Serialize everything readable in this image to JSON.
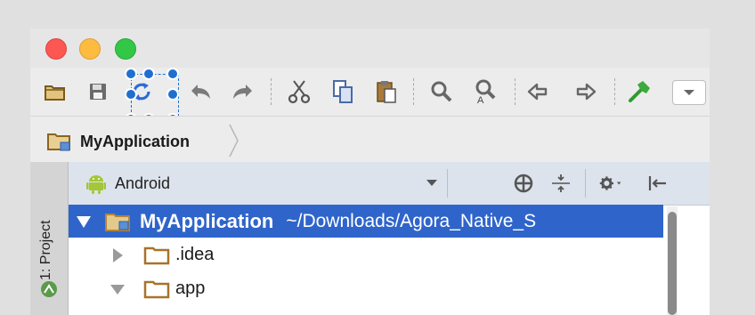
{
  "window": {
    "traffic_lights": [
      "close",
      "minimize",
      "zoom"
    ]
  },
  "toolbar": {
    "buttons": [
      {
        "icon": "open-folder-icon"
      },
      {
        "icon": "save-all-icon"
      },
      {
        "icon": "sync-icon"
      },
      {
        "icon": "undo-icon"
      },
      {
        "icon": "redo-icon"
      },
      {
        "icon": "cut-icon"
      },
      {
        "icon": "copy-icon"
      },
      {
        "icon": "paste-icon"
      },
      {
        "icon": "find-icon"
      },
      {
        "icon": "replace-icon"
      },
      {
        "icon": "back-icon"
      },
      {
        "icon": "forward-icon"
      },
      {
        "icon": "make-project-hammer-icon"
      },
      {
        "icon": "run-configuration-dropdown"
      }
    ],
    "selected_button": "sync-icon"
  },
  "breadcrumb": {
    "project": "MyApplication"
  },
  "side_tool_window": {
    "label": "1: Project"
  },
  "project_panel": {
    "view_mode": "Android",
    "header_actions": [
      "scroll-from-source-icon",
      "collapse-all-icon",
      "settings-icon",
      "hide-panel-icon"
    ],
    "tree": {
      "root": {
        "label": "MyApplication",
        "path": "~/Downloads/Agora_Native_S",
        "expanded": true,
        "selected": true
      },
      "children": [
        {
          "label": ".idea",
          "expanded": false
        },
        {
          "label": "app",
          "expanded": true
        }
      ]
    }
  },
  "colors": {
    "selection_blue": "#2f65ca",
    "handle_blue": "#1f6fd1",
    "android_green": "#a4c639",
    "folder_brown": "#b07a2a",
    "hammer_green": "#3caa3c"
  }
}
